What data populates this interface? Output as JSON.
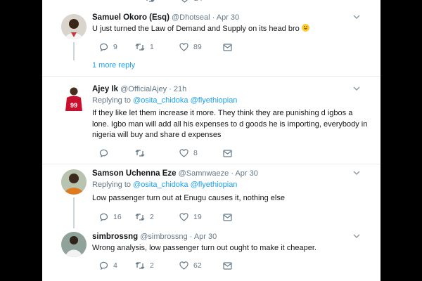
{
  "top_counts": {
    "replies": "",
    "likes": "24"
  },
  "more_replies": "1 more reply",
  "tweets": [
    {
      "name": "Samuel Okoro (Esq)",
      "handle": "@Dhotseal",
      "time": "· Apr 30",
      "text": "U just turned the Law of Demand and Supply on its head bro",
      "emoji": "grinning-face",
      "replies": "9",
      "retweets": "1",
      "likes": "89"
    },
    {
      "name": "Ajey Ik",
      "handle": "@OfficialAjey",
      "time": "· 21h",
      "replying_label": "Replying to",
      "replying": [
        "@osita_chidoka",
        "@flyethiopian"
      ],
      "text_lines": [
        "If they like let them increase it more. They think they are punishing d igbos a",
        "lone. Igbo man will add all his expenses to d goods he is importing, everybody in",
        "nigeria will buy and share d expenses"
      ],
      "replies": "",
      "retweets": "",
      "likes": "8"
    },
    {
      "name": "Samson Uchenna Eze",
      "handle": "@Samnwaeze",
      "time": "· Apr 30",
      "replying_label": "Replying to",
      "replying": [
        "@osita_chidoka",
        "@flyethiopian"
      ],
      "text": "Low passenger turn out at Enugu causes it, nothing else",
      "replies": "16",
      "retweets": "2",
      "likes": "19"
    },
    {
      "name": "simbrossng",
      "handle": "@simbrossng",
      "time": "· Apr 30",
      "text": "Wrong analysis, low passenger turn out ought to make it cheaper.",
      "replies": "4",
      "retweets": "2",
      "likes": "62"
    }
  ],
  "colors": {
    "background": "#000000",
    "card": "#ffffff",
    "link": "#1da1f2",
    "text": "#14171a",
    "muted": "#657786",
    "divider": "#e6ecf0"
  }
}
